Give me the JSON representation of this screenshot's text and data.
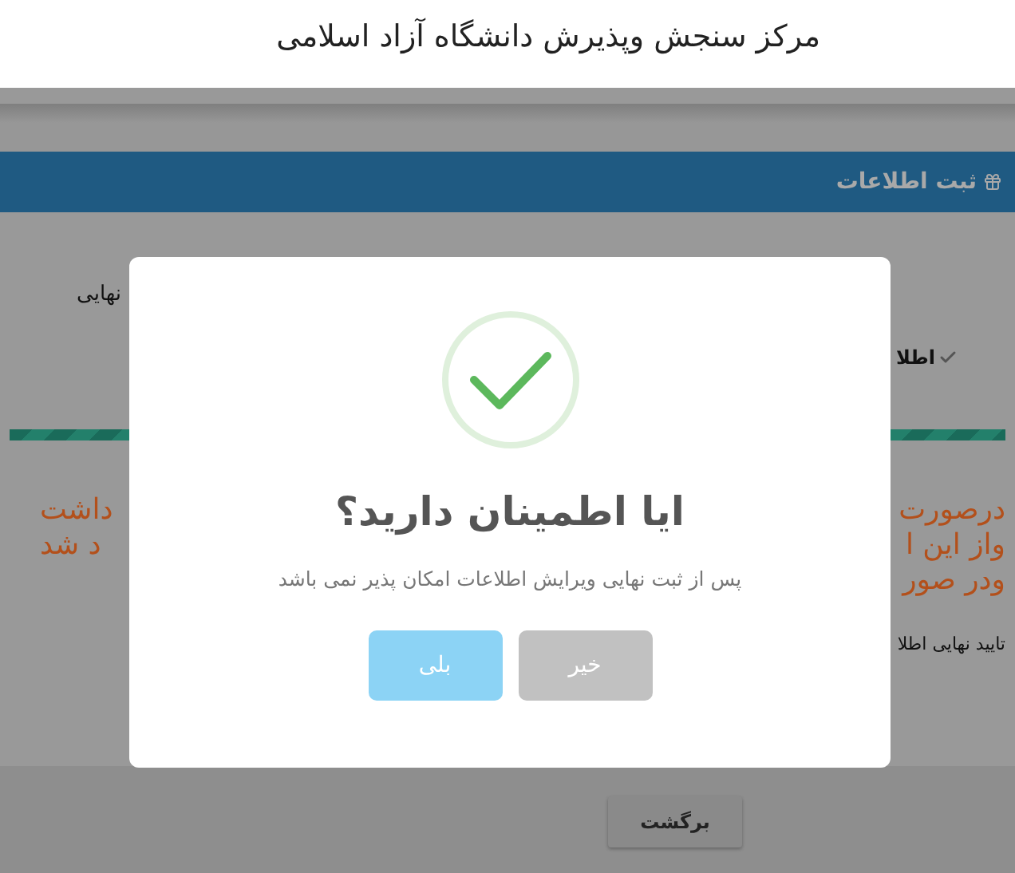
{
  "header": {
    "title": "مرکز سنجش وپذیرش دانشگاه آزاد اسلامی"
  },
  "panel": {
    "title": "ثبت اطلاعات",
    "step_left": "نهایی",
    "step_right": "اطلا",
    "progress": {
      "level": 1
    },
    "warning_right": [
      "درصورت",
      "واز این ا",
      "ودر صور"
    ],
    "warning_left": [
      "داشت",
      "د شد"
    ],
    "confirm_label": "تایید نهایی اطلا"
  },
  "dialog": {
    "title": "ایا اطمینان دارید؟",
    "message": "پس از ثبت نهایی ویرایش اطلاعات امکان پذیر نمی باشد",
    "buttons": [
      {
        "label": "خیر",
        "kind": "cancel"
      },
      {
        "label": "بلی",
        "kind": "confirm"
      }
    ]
  },
  "footer": {
    "back_button": "برگشت"
  }
}
